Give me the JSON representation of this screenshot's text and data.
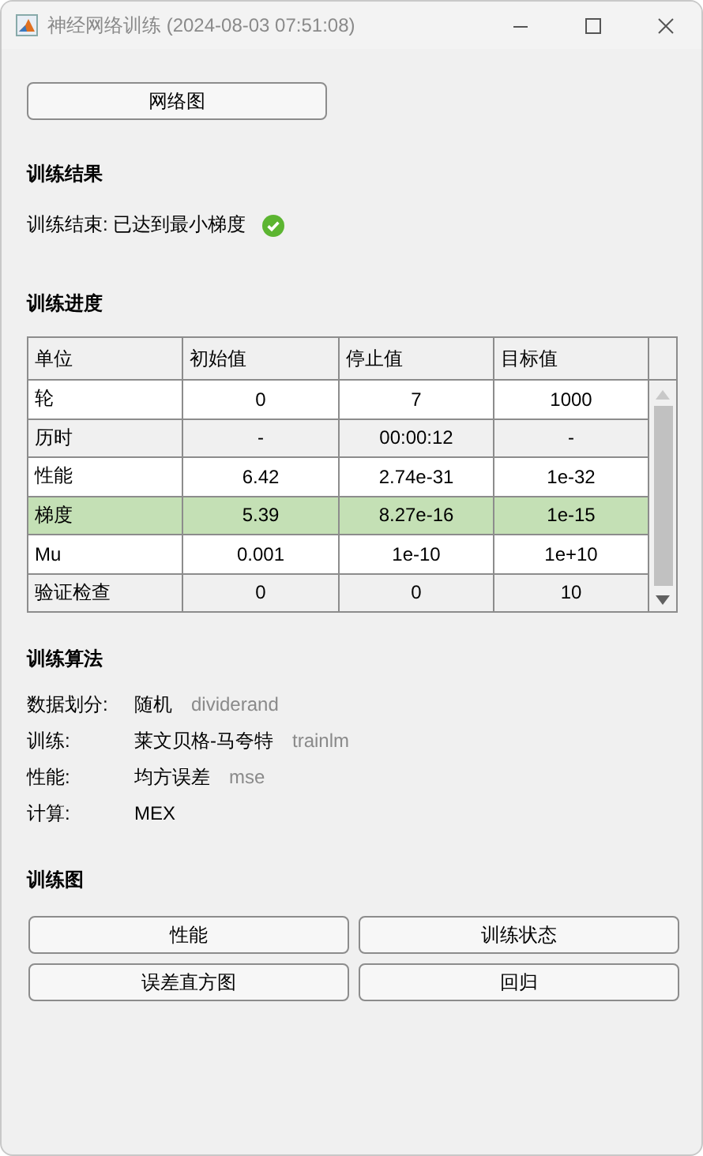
{
  "window": {
    "title": "神经网络训练 (2024-08-03 07:51:08)"
  },
  "network_button": "网络图",
  "results": {
    "heading": "训练结果",
    "message": "训练结束: 已达到最小梯度",
    "success": true
  },
  "progress": {
    "heading": "训练进度",
    "columns": [
      "单位",
      "初始值",
      "停止值",
      "目标值"
    ],
    "rows": [
      {
        "cells": [
          "轮",
          "0",
          "7",
          "1000"
        ],
        "highlighted": false
      },
      {
        "cells": [
          "历时",
          "-",
          "00:00:12",
          "-"
        ],
        "highlighted": false
      },
      {
        "cells": [
          "性能",
          "6.42",
          "2.74e-31",
          "1e-32"
        ],
        "highlighted": false
      },
      {
        "cells": [
          "梯度",
          "5.39",
          "8.27e-16",
          "1e-15"
        ],
        "highlighted": true
      },
      {
        "cells": [
          "Mu",
          "0.001",
          "1e-10",
          "1e+10"
        ],
        "highlighted": false
      },
      {
        "cells": [
          "验证检查",
          "0",
          "0",
          "10"
        ],
        "highlighted": false
      }
    ]
  },
  "algorithms": {
    "heading": "训练算法",
    "items": [
      {
        "label": "数据划分:",
        "value": "随机",
        "code": "dividerand"
      },
      {
        "label": "训练:",
        "value": "莱文贝格-马夸特",
        "code": "trainlm"
      },
      {
        "label": "性能:",
        "value": "均方误差",
        "code": "mse"
      },
      {
        "label": "计算:",
        "value": "MEX"
      }
    ]
  },
  "plots": {
    "heading": "训练图",
    "buttons": [
      "性能",
      "训练状态",
      "误差直方图",
      "回归"
    ]
  }
}
